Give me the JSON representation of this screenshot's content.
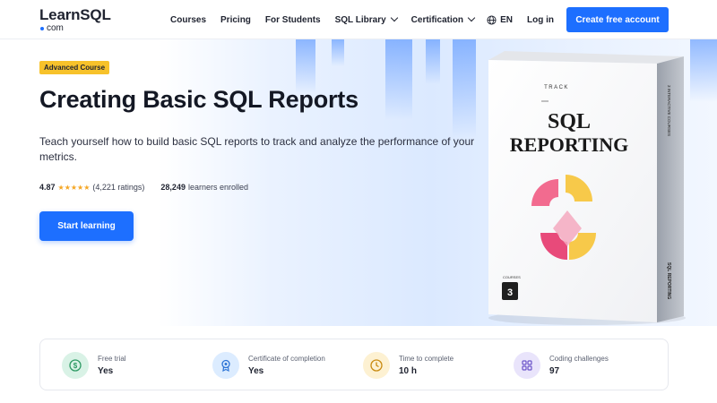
{
  "logo": {
    "word": "LearnSQL",
    "sub": "com"
  },
  "nav": {
    "items": [
      {
        "label": "Courses",
        "dropdown": false
      },
      {
        "label": "Pricing",
        "dropdown": false
      },
      {
        "label": "For Students",
        "dropdown": false
      },
      {
        "label": "SQL Library",
        "dropdown": true
      },
      {
        "label": "Certification",
        "dropdown": true
      }
    ],
    "language": "EN",
    "login": "Log in",
    "cta": "Create free account"
  },
  "hero": {
    "badge": "Advanced Course",
    "title": "Creating Basic SQL Reports",
    "description": "Teach yourself how to build basic SQL reports to track and analyze the performance of your metrics.",
    "rating": "4.87",
    "stars": "★★★★★",
    "ratings_count": "(4,221 ratings)",
    "learners": "28,249",
    "learners_label": "learners enrolled",
    "start_button": "Start learning"
  },
  "product_box": {
    "track_label": "TRACK",
    "title_line1": "SQL",
    "title_line2": "REPORTING",
    "courses_label": "COURSES",
    "courses_count": "3",
    "side_top": "3 INTERACTIVE COURSES",
    "side_bottom": "SQL REPORTING"
  },
  "features": [
    {
      "label": "Free trial",
      "value": "Yes",
      "icon": "dollar-icon",
      "color": "#d9f2e6",
      "fg": "#2e9a64"
    },
    {
      "label": "Certificate of completion",
      "value": "Yes",
      "icon": "certificate-icon",
      "color": "#dcecff",
      "fg": "#2d74d6"
    },
    {
      "label": "Time to complete",
      "value": "10 h",
      "icon": "clock-icon",
      "color": "#fdf1d2",
      "fg": "#c98a10"
    },
    {
      "label": "Coding challenges",
      "value": "97",
      "icon": "grid-icon",
      "color": "#e9e4fb",
      "fg": "#6b53c9"
    }
  ],
  "colors": {
    "accent": "#1d6fff",
    "badge": "#f7c22b",
    "star": "#f5a623"
  }
}
